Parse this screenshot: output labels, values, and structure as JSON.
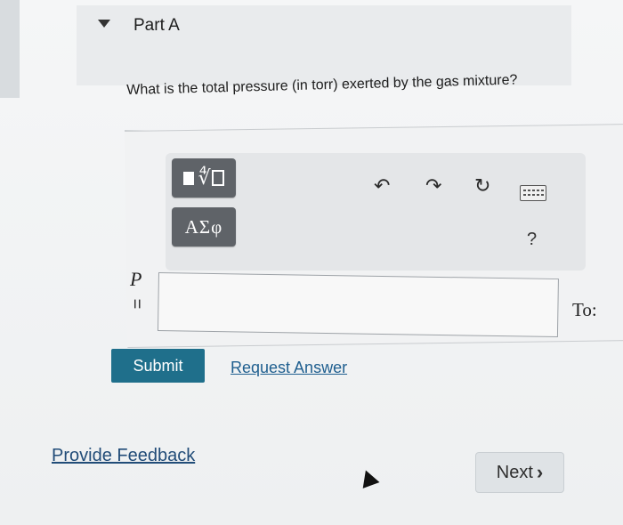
{
  "part": {
    "title": "Part A"
  },
  "question": {
    "text": "What is the total pressure (in torr) exerted by the gas mixture?"
  },
  "toolbar": {
    "symbols_label": "ΑΣφ",
    "help_label": "?"
  },
  "answer": {
    "variable": "P",
    "equals": "=",
    "value": "",
    "unit_text": "To:"
  },
  "actions": {
    "submit_label": "Submit",
    "request_answer_label": "Request Answer"
  },
  "footer": {
    "feedback_label": "Provide Feedback",
    "next_label": "Next"
  },
  "icons": {
    "part_toggle": "caret-down-icon",
    "templates": "templates-icon",
    "undo": "undo-icon",
    "redo": "redo-icon",
    "reset": "reset-icon",
    "keyboard": "keyboard-icon",
    "next": "chevron-right-icon",
    "cursor": "mouse-cursor-icon"
  },
  "colors": {
    "submit": "#1f6f8b",
    "link": "#1f5f8f",
    "tool_button": "#5f6368"
  }
}
